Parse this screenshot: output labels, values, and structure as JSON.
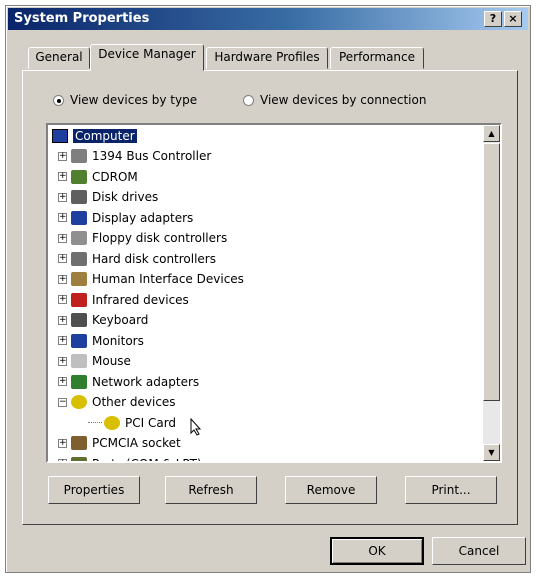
{
  "window": {
    "title": "System Properties",
    "help_btn": "?",
    "close_btn": "×"
  },
  "tabs": [
    "General",
    "Device Manager",
    "Hardware Profiles",
    "Performance"
  ],
  "active_tab": "Device Manager",
  "view_options": {
    "by_type": "View devices by type",
    "by_connection": "View devices by connection",
    "selected": "by_type"
  },
  "tree": {
    "root": "Computer",
    "items": [
      {
        "label": "1394 Bus Controller",
        "expander": "+",
        "icon": "bus-controller-icon"
      },
      {
        "label": "CDROM",
        "expander": "+",
        "icon": "cdrom-icon"
      },
      {
        "label": "Disk drives",
        "expander": "+",
        "icon": "disk-drive-icon"
      },
      {
        "label": "Display adapters",
        "expander": "+",
        "icon": "display-adapter-icon"
      },
      {
        "label": "Floppy disk controllers",
        "expander": "+",
        "icon": "floppy-controller-icon"
      },
      {
        "label": "Hard disk controllers",
        "expander": "+",
        "icon": "hard-disk-controller-icon"
      },
      {
        "label": "Human Interface Devices",
        "expander": "+",
        "icon": "hid-icon"
      },
      {
        "label": "Infrared devices",
        "expander": "+",
        "icon": "infrared-icon"
      },
      {
        "label": "Keyboard",
        "expander": "+",
        "icon": "keyboard-icon"
      },
      {
        "label": "Monitors",
        "expander": "+",
        "icon": "monitor-icon"
      },
      {
        "label": "Mouse",
        "expander": "+",
        "icon": "mouse-icon"
      },
      {
        "label": "Network adapters",
        "expander": "+",
        "icon": "network-adapter-icon"
      },
      {
        "label": "Other devices",
        "expander": "−",
        "icon": "question-icon"
      },
      {
        "label": "PCI Card",
        "expander": "",
        "icon": "question-icon",
        "child": true
      },
      {
        "label": "PCMCIA socket",
        "expander": "+",
        "icon": "pcmcia-icon"
      },
      {
        "label": "Ports (COM & LPT)",
        "expander": "+",
        "icon": "port-icon"
      }
    ]
  },
  "buttons": {
    "properties": "Properties",
    "refresh": "Refresh",
    "remove": "Remove",
    "print": "Print...",
    "ok": "OK",
    "cancel": "Cancel"
  }
}
